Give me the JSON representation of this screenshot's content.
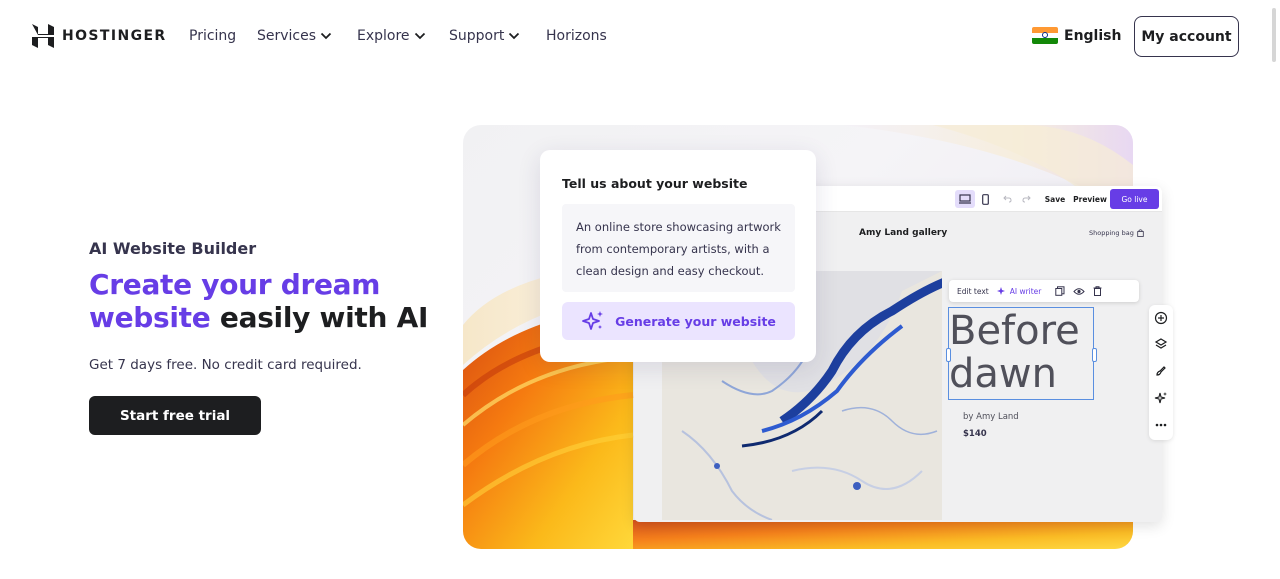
{
  "nav": {
    "brand": "HOSTINGER",
    "items": [
      {
        "label": "Pricing",
        "dropdown": false
      },
      {
        "label": "Services",
        "dropdown": true
      },
      {
        "label": "Explore",
        "dropdown": true
      },
      {
        "label": "Support",
        "dropdown": true
      },
      {
        "label": "Horizons",
        "dropdown": false
      }
    ],
    "language": "English",
    "account_button": "My account"
  },
  "hero": {
    "eyebrow": "AI Website Builder",
    "headline_accent": "Create your dream website",
    "headline_rest": "easily with AI",
    "headline_accent_line1": "Create your dream",
    "headline_accent_line2": "website",
    "subtext": "Get 7 days free. No credit card required.",
    "cta": "Start free trial"
  },
  "prompt_card": {
    "title": "Tell us about your website",
    "description": "An online store showcasing artwork from contemporary artists, with a clean design and easy checkout.",
    "line1": "An online store showcasing artwork",
    "line2": "from contemporary artists, with a",
    "line3": "clean design and easy checkout.",
    "button": "Generate your website"
  },
  "editor": {
    "toolbar": {
      "save": "Save",
      "preview": "Preview",
      "go_live": "Go live"
    },
    "site_title": "Amy Land gallery",
    "shopping_bag": "Shopping bag",
    "edit_bar": {
      "edit_text": "Edit text",
      "ai_writer": "AI writer"
    },
    "artwork_title_line1": "Before",
    "artwork_title_line2": "dawn",
    "artist": "by Amy Land",
    "price": "$140"
  },
  "colors": {
    "accent": "#673de6",
    "dark": "#1d1e20",
    "text": "#36344d",
    "accent_light": "#ebe4ff"
  }
}
